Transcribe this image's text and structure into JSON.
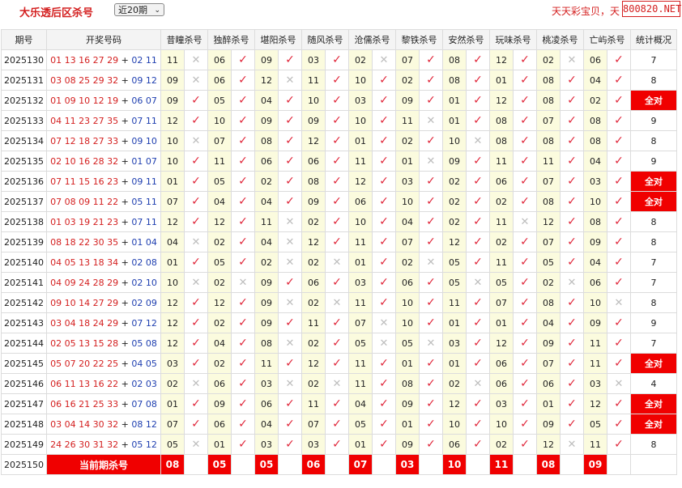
{
  "header": {
    "title": "大乐透后区杀号",
    "period_select": "近20期",
    "ad_text": "天天彩宝贝，天",
    "ad_site": "800820.NET"
  },
  "table": {
    "col_issue": "期号",
    "col_draw": "开奖号码",
    "col_stat": "统计概况",
    "experts": [
      "昔瞳杀号",
      "独醉杀号",
      "堪阳杀号",
      "随风杀号",
      "沧儒杀号",
      "黎铁杀号",
      "安然杀号",
      "玩味杀号",
      "桃凌杀号",
      "亡屿杀号"
    ],
    "rows": [
      {
        "issue": "2025130",
        "front": "01 13 16 27 29",
        "back": "02 11",
        "kills": [
          "11",
          "06",
          "09",
          "03",
          "02",
          "07",
          "08",
          "12",
          "02",
          "06"
        ],
        "hits": [
          0,
          1,
          1,
          1,
          0,
          1,
          1,
          1,
          0,
          1
        ],
        "stat": "7"
      },
      {
        "issue": "2025131",
        "front": "03 08 25 29 32",
        "back": "09 12",
        "kills": [
          "09",
          "06",
          "12",
          "11",
          "10",
          "02",
          "08",
          "01",
          "08",
          "04"
        ],
        "hits": [
          0,
          1,
          0,
          1,
          1,
          1,
          1,
          1,
          1,
          1
        ],
        "stat": "8"
      },
      {
        "issue": "2025132",
        "front": "01 09 10 12 19",
        "back": "06 07",
        "kills": [
          "09",
          "05",
          "04",
          "10",
          "03",
          "09",
          "01",
          "12",
          "08",
          "02"
        ],
        "hits": [
          1,
          1,
          1,
          1,
          1,
          1,
          1,
          1,
          1,
          1
        ],
        "stat": "全对"
      },
      {
        "issue": "2025133",
        "front": "04 11 23 27 35",
        "back": "07 11",
        "kills": [
          "12",
          "10",
          "09",
          "09",
          "10",
          "11",
          "01",
          "08",
          "07",
          "08"
        ],
        "hits": [
          1,
          1,
          1,
          1,
          1,
          0,
          1,
          1,
          1,
          1
        ],
        "stat": "9"
      },
      {
        "issue": "2025134",
        "front": "07 12 18 27 33",
        "back": "09 10",
        "kills": [
          "10",
          "07",
          "08",
          "12",
          "01",
          "02",
          "10",
          "08",
          "08",
          "08"
        ],
        "hits": [
          0,
          1,
          1,
          1,
          1,
          1,
          0,
          1,
          1,
          1
        ],
        "stat": "8"
      },
      {
        "issue": "2025135",
        "front": "02 10 16 28 32",
        "back": "01 07",
        "kills": [
          "10",
          "11",
          "06",
          "06",
          "11",
          "01",
          "09",
          "11",
          "11",
          "04"
        ],
        "hits": [
          1,
          1,
          1,
          1,
          1,
          0,
          1,
          1,
          1,
          1
        ],
        "stat": "9"
      },
      {
        "issue": "2025136",
        "front": "07 11 15 16 23",
        "back": "09 11",
        "kills": [
          "01",
          "05",
          "02",
          "08",
          "12",
          "03",
          "02",
          "06",
          "07",
          "03"
        ],
        "hits": [
          1,
          1,
          1,
          1,
          1,
          1,
          1,
          1,
          1,
          1
        ],
        "stat": "全对"
      },
      {
        "issue": "2025137",
        "front": "07 08 09 11 22",
        "back": "05 11",
        "kills": [
          "07",
          "04",
          "04",
          "09",
          "06",
          "10",
          "02",
          "02",
          "08",
          "10"
        ],
        "hits": [
          1,
          1,
          1,
          1,
          1,
          1,
          1,
          1,
          1,
          1
        ],
        "stat": "全对"
      },
      {
        "issue": "2025138",
        "front": "01 03 19 21 23",
        "back": "07 11",
        "kills": [
          "12",
          "12",
          "11",
          "02",
          "10",
          "04",
          "02",
          "11",
          "12",
          "08"
        ],
        "hits": [
          1,
          1,
          0,
          1,
          1,
          1,
          1,
          0,
          1,
          1
        ],
        "stat": "8"
      },
      {
        "issue": "2025139",
        "front": "08 18 22 30 35",
        "back": "01 04",
        "kills": [
          "04",
          "02",
          "04",
          "12",
          "11",
          "07",
          "12",
          "02",
          "07",
          "09"
        ],
        "hits": [
          0,
          1,
          0,
          1,
          1,
          1,
          1,
          1,
          1,
          1
        ],
        "stat": "8"
      },
      {
        "issue": "2025140",
        "front": "04 05 13 18 34",
        "back": "02 08",
        "kills": [
          "01",
          "05",
          "02",
          "02",
          "01",
          "02",
          "05",
          "11",
          "05",
          "04"
        ],
        "hits": [
          1,
          1,
          0,
          0,
          1,
          0,
          1,
          1,
          1,
          1
        ],
        "stat": "7"
      },
      {
        "issue": "2025141",
        "front": "04 09 24 28 29",
        "back": "02 10",
        "kills": [
          "10",
          "02",
          "09",
          "06",
          "03",
          "06",
          "05",
          "05",
          "02",
          "06"
        ],
        "hits": [
          0,
          0,
          1,
          1,
          1,
          1,
          0,
          1,
          0,
          1
        ],
        "stat": "7"
      },
      {
        "issue": "2025142",
        "front": "09 10 14 27 29",
        "back": "02 09",
        "kills": [
          "12",
          "12",
          "09",
          "02",
          "11",
          "10",
          "11",
          "07",
          "08",
          "10"
        ],
        "hits": [
          1,
          1,
          0,
          0,
          1,
          1,
          1,
          1,
          1,
          0
        ],
        "stat": "8"
      },
      {
        "issue": "2025143",
        "front": "03 04 18 24 29",
        "back": "07 12",
        "kills": [
          "12",
          "02",
          "09",
          "11",
          "07",
          "10",
          "01",
          "01",
          "04",
          "09"
        ],
        "hits": [
          1,
          1,
          1,
          1,
          0,
          1,
          1,
          1,
          1,
          1
        ],
        "stat": "9"
      },
      {
        "issue": "2025144",
        "front": "02 05 13 15 28",
        "back": "05 08",
        "kills": [
          "12",
          "04",
          "08",
          "02",
          "05",
          "05",
          "03",
          "12",
          "09",
          "11"
        ],
        "hits": [
          1,
          1,
          0,
          1,
          0,
          0,
          1,
          1,
          1,
          1
        ],
        "stat": "7"
      },
      {
        "issue": "2025145",
        "front": "05 07 20 22 25",
        "back": "04 05",
        "kills": [
          "03",
          "02",
          "11",
          "12",
          "11",
          "01",
          "01",
          "06",
          "07",
          "11"
        ],
        "hits": [
          1,
          1,
          1,
          1,
          1,
          1,
          1,
          1,
          1,
          1
        ],
        "stat": "全对"
      },
      {
        "issue": "2025146",
        "front": "06 11 13 16 22",
        "back": "02 03",
        "kills": [
          "02",
          "06",
          "03",
          "02",
          "11",
          "08",
          "02",
          "06",
          "06",
          "03"
        ],
        "hits": [
          0,
          1,
          0,
          0,
          1,
          1,
          0,
          1,
          1,
          0
        ],
        "stat": "4"
      },
      {
        "issue": "2025147",
        "front": "06 16 21 25 33",
        "back": "07 08",
        "kills": [
          "01",
          "09",
          "06",
          "11",
          "04",
          "09",
          "12",
          "03",
          "01",
          "12"
        ],
        "hits": [
          1,
          1,
          1,
          1,
          1,
          1,
          1,
          1,
          1,
          1
        ],
        "stat": "全对"
      },
      {
        "issue": "2025148",
        "front": "03 04 14 30 32",
        "back": "08 12",
        "kills": [
          "07",
          "06",
          "04",
          "07",
          "05",
          "01",
          "10",
          "10",
          "09",
          "05"
        ],
        "hits": [
          1,
          1,
          1,
          1,
          1,
          1,
          1,
          1,
          1,
          1
        ],
        "stat": "全对"
      },
      {
        "issue": "2025149",
        "front": "24 26 30 31 32",
        "back": "05 12",
        "kills": [
          "05",
          "01",
          "03",
          "03",
          "01",
          "09",
          "06",
          "02",
          "12",
          "11"
        ],
        "hits": [
          0,
          1,
          1,
          1,
          1,
          1,
          1,
          1,
          0,
          1
        ],
        "stat": "8"
      }
    ],
    "current": {
      "issue": "2025150",
      "label": "当前期杀号",
      "kills": [
        "08",
        "05",
        "05",
        "06",
        "07",
        "03",
        "10",
        "11",
        "08",
        "09"
      ]
    }
  },
  "icons": {
    "hit": "check-mark",
    "miss": "cross-mark"
  },
  "colors": {
    "accent_red": "#f00000",
    "front_red": "#d42020",
    "back_blue": "#1f3fb0",
    "num_bg": "#fbfbde"
  }
}
